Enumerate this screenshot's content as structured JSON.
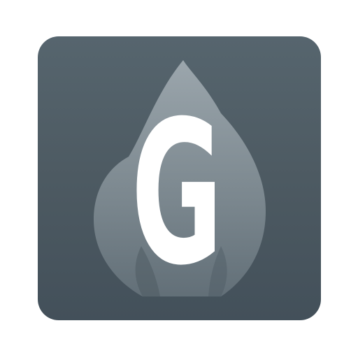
{
  "app_icon": {
    "letter": "G",
    "icon_name": "flame-icon",
    "colors": {
      "background_top": "#56656e",
      "background_bottom": "#43505a",
      "flame": "#9aa6ad",
      "letter": "#ffffff"
    }
  }
}
